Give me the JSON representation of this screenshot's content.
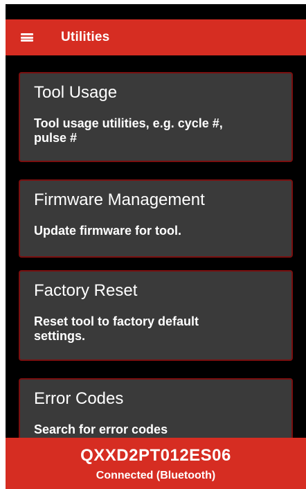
{
  "app_bar": {
    "title": "Utilities",
    "menu_icon": "hamburger-menu-icon"
  },
  "cards": [
    {
      "title": "Tool Usage",
      "description": "Tool usage utilities, e.g. cycle #, pulse #"
    },
    {
      "title": "Firmware Management",
      "description": "Update firmware for tool."
    },
    {
      "title": "Factory Reset",
      "description": "Reset tool to factory default settings."
    },
    {
      "title": "Error Codes",
      "description": "Search for error codes"
    }
  ],
  "status": {
    "device_id": "QXXD2PT012ES06",
    "connection": "Connected (Bluetooth)"
  },
  "colors": {
    "accent": "#d62d22",
    "background": "#000000",
    "card": "#3a3a3a",
    "card_border": "#7a0f0f"
  }
}
